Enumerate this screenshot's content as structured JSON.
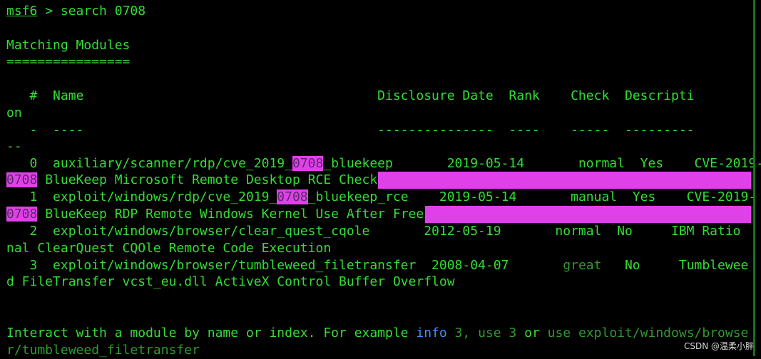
{
  "prompt": {
    "name": "msf6",
    "sep": " > ",
    "command": "search 0708"
  },
  "heading": "Matching Modules",
  "heading_rule": "================",
  "table": {
    "header_a": "   #  Name                                      Disclosure Date  Rank    Check  Descripti",
    "header_b": "on",
    "divider_a": "   -  ----                                      ---------------  ----    -----  ---------",
    "divider_b": "--",
    "rows": [
      {
        "pre": "   0  auxiliary/scanner/rdp/cve_2019_",
        "match": "0708",
        "post": "_bluekeep       2019-05-14       normal  Yes    CVE-2019-",
        "wrap_match": "0708",
        "wrap_text": " BlueKeep Microsoft Remote Desktop RCE Check"
      },
      {
        "pre": "   1  exploit/windows/rdp/cve_2019_",
        "match": "0708",
        "post": "_bluekeep_rce    2019-05-14       manual  Yes    CVE-2019-",
        "wrap_match": "0708",
        "wrap_text": " BlueKeep RDP Remote Windows Kernel Use After Free"
      },
      {
        "text": "   2  exploit/windows/browser/clear_quest_cqole       2012-05-19       normal  No     IBM Ratio",
        "wrap_text": "nal ClearQuest CQOle Remote Code Execution"
      },
      {
        "pre": "   3  exploit/windows/browser/tumbleweed_filetransfer  2008-04-07       ",
        "rank": "great",
        "post": "   No     Tumblewee",
        "wrap_text": "d FileTransfer vcst_eu.dll ActiveX Control Buffer Overflow"
      }
    ]
  },
  "footer": {
    "p1": "Interact with a module by name or index. For example ",
    "info": "info",
    "p2": " 3, ",
    "use": "use 3",
    "p3": " or ",
    "use_path": "use exploit/windows/browse",
    "wrap": "r/tumbleweed_filetransfer"
  },
  "watermark": "CSDN @温柔小胖",
  "colors": {
    "text": "#33dd33",
    "highlight": "#e040e8",
    "info": "#3c8fff",
    "background": "#000000"
  }
}
